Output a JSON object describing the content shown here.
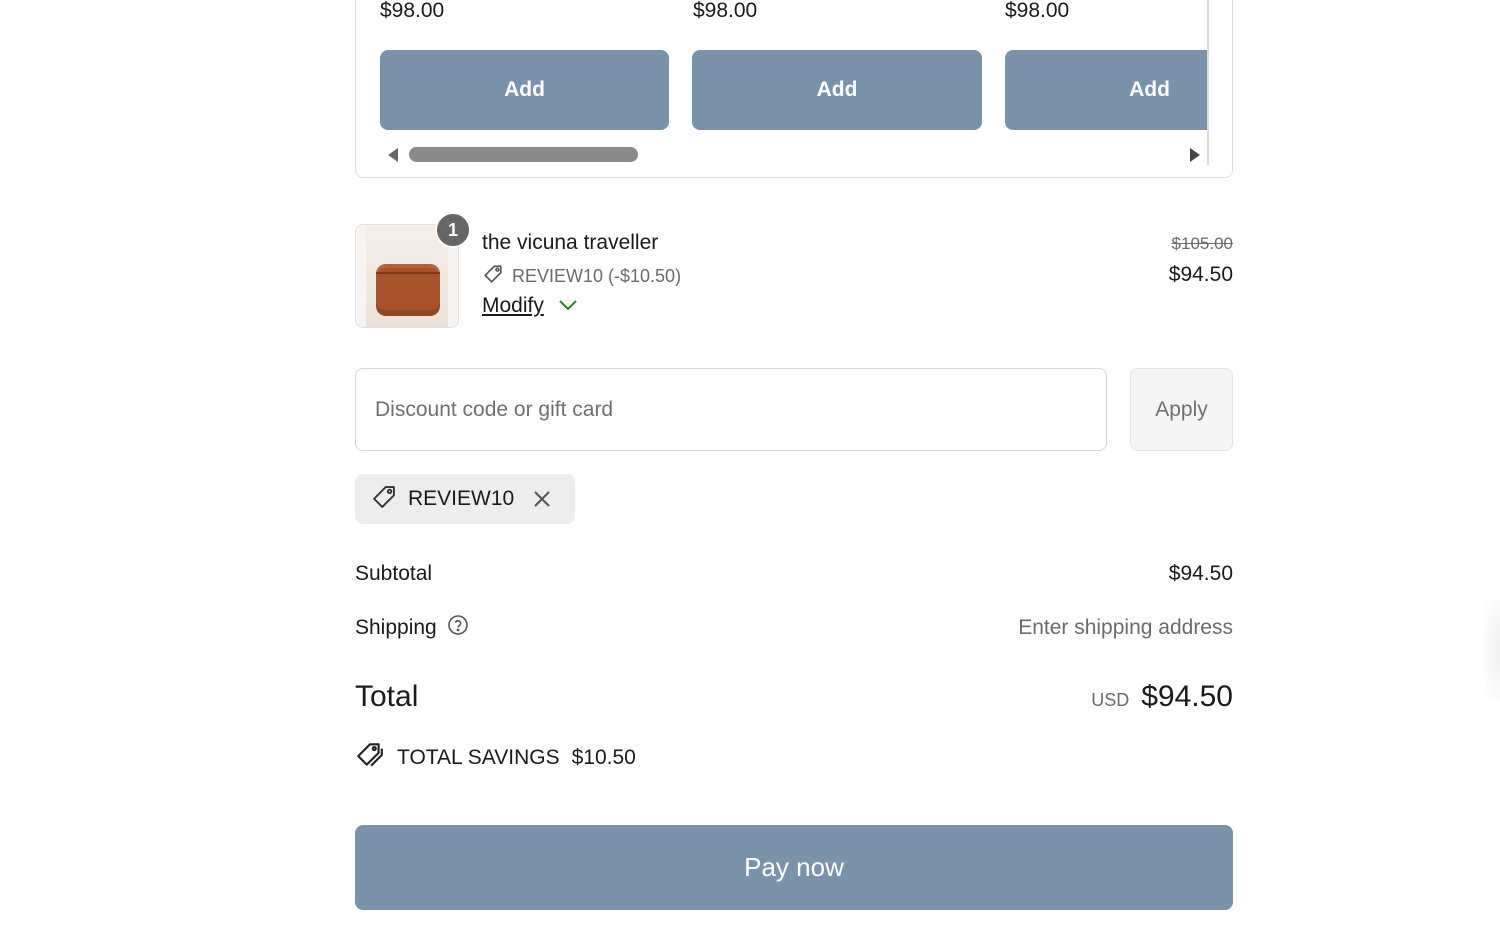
{
  "upsell": {
    "items": [
      {
        "price": "$98.00",
        "add_label": "Add"
      },
      {
        "price": "$98.00",
        "add_label": "Add"
      },
      {
        "price": "$98.00",
        "add_label": "Add"
      }
    ]
  },
  "cart": {
    "item": {
      "quantity": "1",
      "name": "the vicuna traveller",
      "discount_text": "REVIEW10 (-$10.50)",
      "modify_label": "Modify",
      "original_price": "$105.00",
      "price": "$94.50"
    }
  },
  "discount": {
    "placeholder": "Discount code or gift card",
    "value": "",
    "apply_label": "Apply",
    "applied_code": "REVIEW10"
  },
  "summary": {
    "subtotal_label": "Subtotal",
    "subtotal_value": "$94.50",
    "shipping_label": "Shipping",
    "shipping_value": "Enter shipping address",
    "total_label": "Total",
    "currency": "USD",
    "total_value": "$94.50",
    "savings_label": "TOTAL SAVINGS",
    "savings_value": "$10.50"
  },
  "actions": {
    "pay_label": "Pay now"
  },
  "colors": {
    "primary_button": "#7b92ab",
    "muted_text": "#6b6b6b",
    "modify_chevron": "#2f7d32"
  }
}
